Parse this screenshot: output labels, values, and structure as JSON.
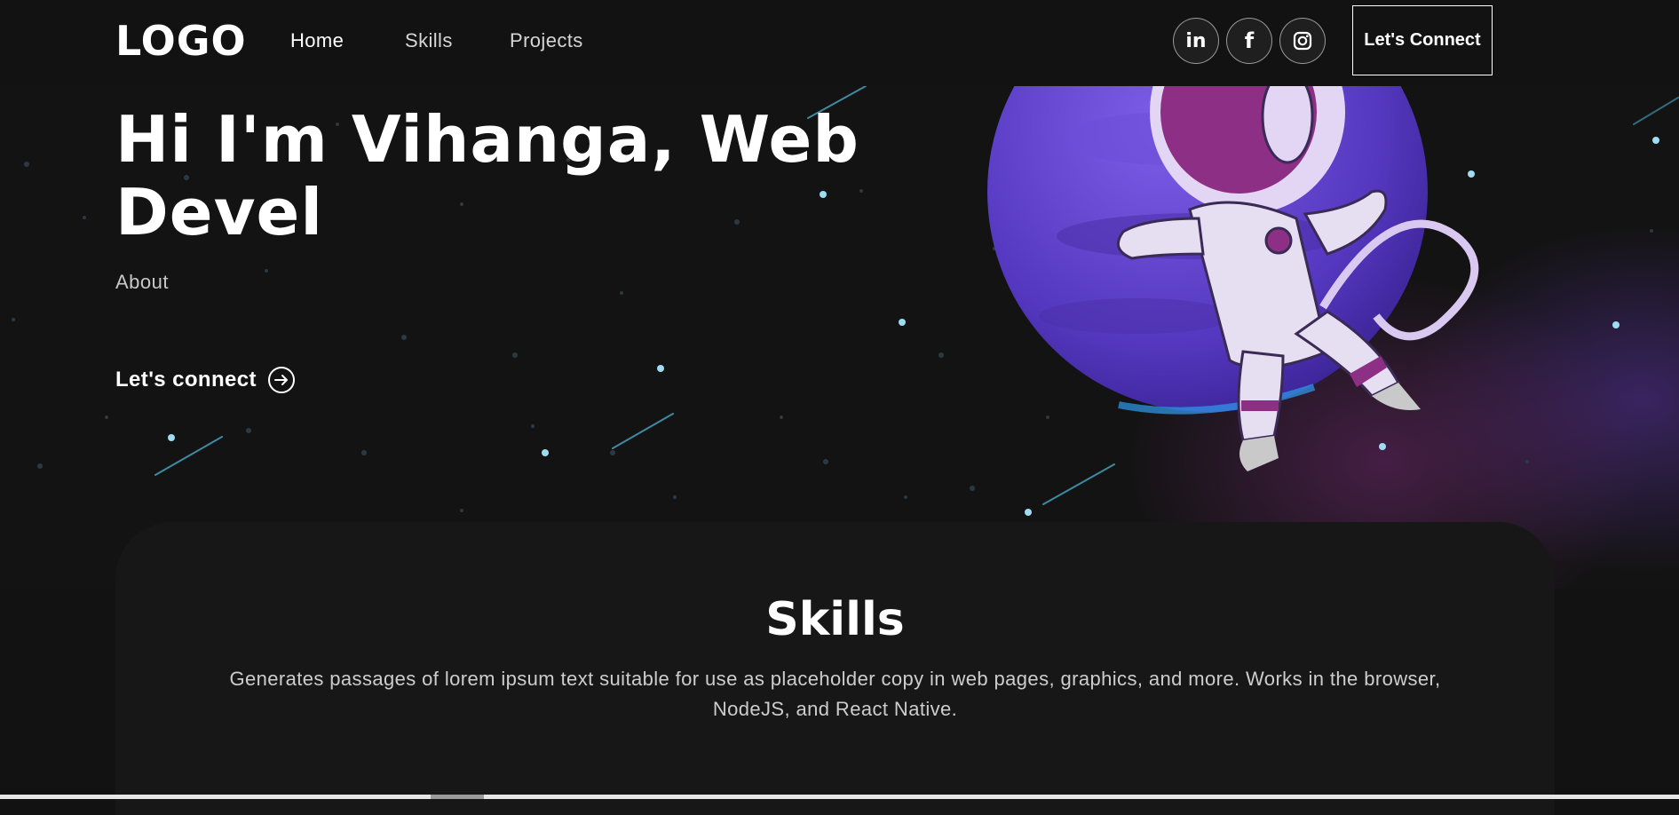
{
  "nav": {
    "logo": "LOGO",
    "links": [
      {
        "label": "Home"
      },
      {
        "label": "Skills"
      },
      {
        "label": "Projects"
      }
    ],
    "social": [
      {
        "icon": "linkedin-icon",
        "glyph": "in"
      },
      {
        "icon": "facebook-icon",
        "glyph": "f"
      },
      {
        "icon": "instagram-icon",
        "glyph": ""
      }
    ],
    "connect_button": "Let's Connect"
  },
  "hero": {
    "title": "Hi I'm Vihanga, Web Devel",
    "about": "About",
    "cta": "Let's connect"
  },
  "skills": {
    "title": "Skills",
    "description": "Generates passages of lorem ipsum text suitable for use as placeholder copy in web pages, graphics, and more. Works in the browser, NodeJS, and React Native."
  },
  "colors": {
    "background": "#121212",
    "planet": "#5b3fc8",
    "suit": "#e6dff2",
    "accent": "#a2307e"
  }
}
